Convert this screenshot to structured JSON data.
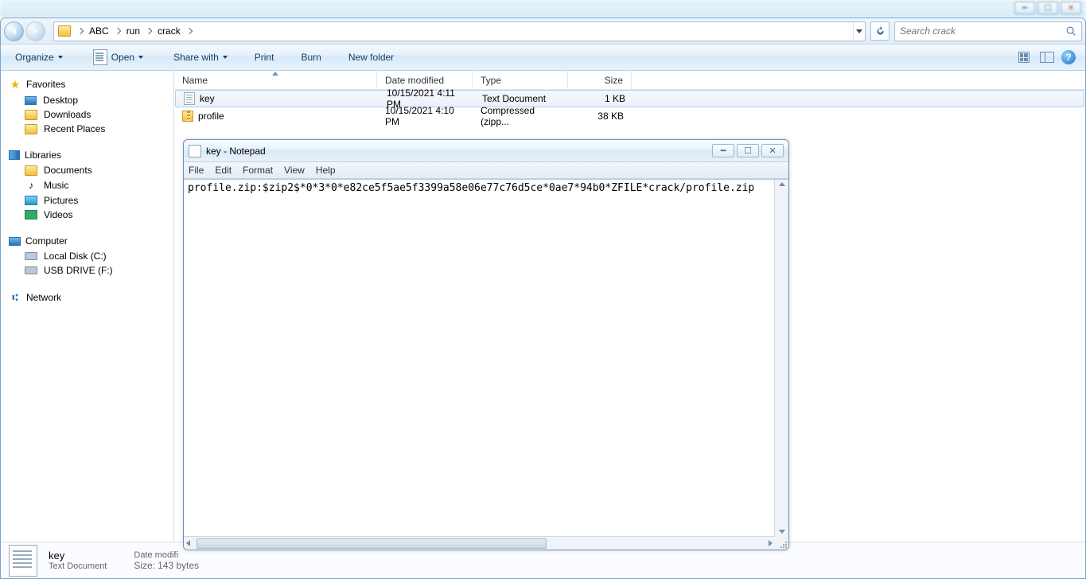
{
  "os_window": {
    "min": "━",
    "max": "☐",
    "close": "✕"
  },
  "nav": {
    "path": [
      "ABC",
      "run",
      "crack"
    ],
    "search_placeholder": "Search crack"
  },
  "toolbar": {
    "organize": "Organize",
    "open": "Open",
    "share": "Share with",
    "print": "Print",
    "burn": "Burn",
    "newfolder": "New folder"
  },
  "sidebar": {
    "favorites": {
      "label": "Favorites",
      "items": [
        "Desktop",
        "Downloads",
        "Recent Places"
      ]
    },
    "libraries": {
      "label": "Libraries",
      "items": [
        "Documents",
        "Music",
        "Pictures",
        "Videos"
      ]
    },
    "computer": {
      "label": "Computer",
      "items": [
        "Local Disk (C:)",
        "USB DRIVE (F:)"
      ]
    },
    "network": {
      "label": "Network"
    }
  },
  "columns": {
    "name": "Name",
    "date": "Date modified",
    "type": "Type",
    "size": "Size"
  },
  "files": [
    {
      "name": "key",
      "date": "10/15/2021 4:11 PM",
      "type": "Text Document",
      "size": "1 KB",
      "kind": "txt",
      "selected": true
    },
    {
      "name": "profile",
      "date": "10/15/2021 4:10 PM",
      "type": "Compressed (zipp...",
      "size": "38 KB",
      "kind": "zip",
      "selected": false
    }
  ],
  "details": {
    "name": "key",
    "type": "Text Document",
    "date_label": "Date modifi",
    "size_label": "Size:",
    "size": "143 bytes"
  },
  "notepad": {
    "title": "key - Notepad",
    "menus": [
      "File",
      "Edit",
      "Format",
      "View",
      "Help"
    ],
    "content": "profile.zip:$zip2$*0*3*0*e82ce5f5ae5f3399a58e06e77c76d5ce*0ae7*94b0*ZFILE*crack/profile.zip",
    "win": {
      "min": "━",
      "max": "☐",
      "close": "✕"
    }
  }
}
